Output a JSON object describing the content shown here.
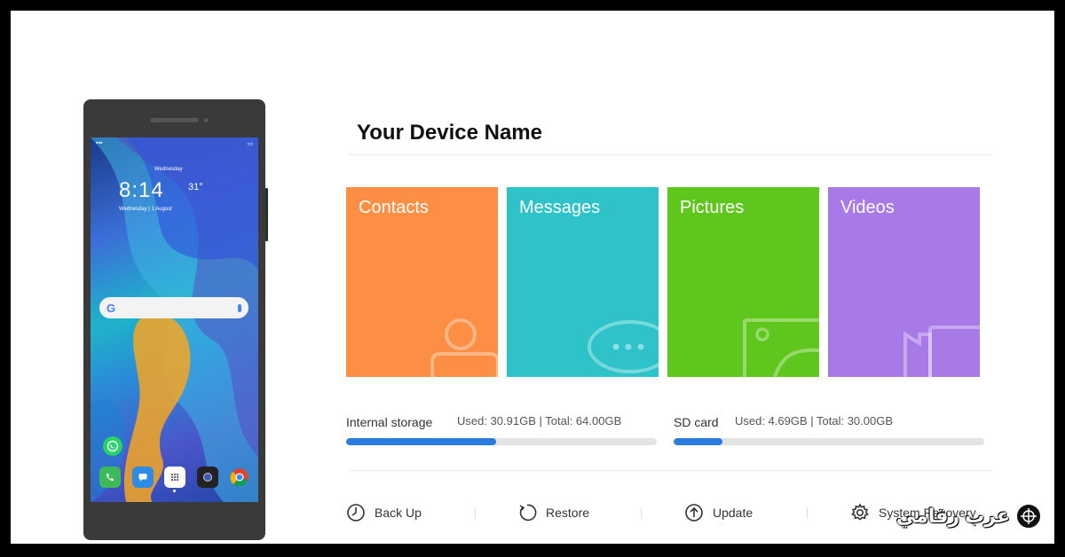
{
  "device": {
    "title": "Your Device Name"
  },
  "phone_screen": {
    "clock": "8:14",
    "clock_city": "Wednesday",
    "date": "Wednesday | 1 August",
    "weather_temp": "31°"
  },
  "tiles": [
    {
      "label": "Contacts",
      "color": "#fc8f43",
      "icon": "person-icon"
    },
    {
      "label": "Messages",
      "color": "#2dc3c8",
      "icon": "chat-bubble-icon"
    },
    {
      "label": "Pictures",
      "color": "#5fc61d",
      "icon": "image-icon"
    },
    {
      "label": "Videos",
      "color": "#a77ae7",
      "icon": "video-camera-icon"
    }
  ],
  "storage": {
    "internal": {
      "label": "Internal storage",
      "stats": "Used: 30.91GB | Total: 64.00GB",
      "used_fraction": 0.483
    },
    "sd": {
      "label": "SD card",
      "stats": "Used: 4.69GB | Total: 30.00GB",
      "used_fraction": 0.156
    }
  },
  "actions": [
    {
      "label": "Back Up",
      "icon": "backup-clock-icon"
    },
    {
      "label": "Restore",
      "icon": "restore-arrow-icon"
    },
    {
      "label": "Update",
      "icon": "update-arrow-icon"
    },
    {
      "label": "System Recovery",
      "icon": "gear-icon"
    }
  ],
  "watermark": {
    "text": "عرب رقامي"
  },
  "colors": {
    "progress": "#2a7ce0",
    "track": "#e3e3e3"
  }
}
